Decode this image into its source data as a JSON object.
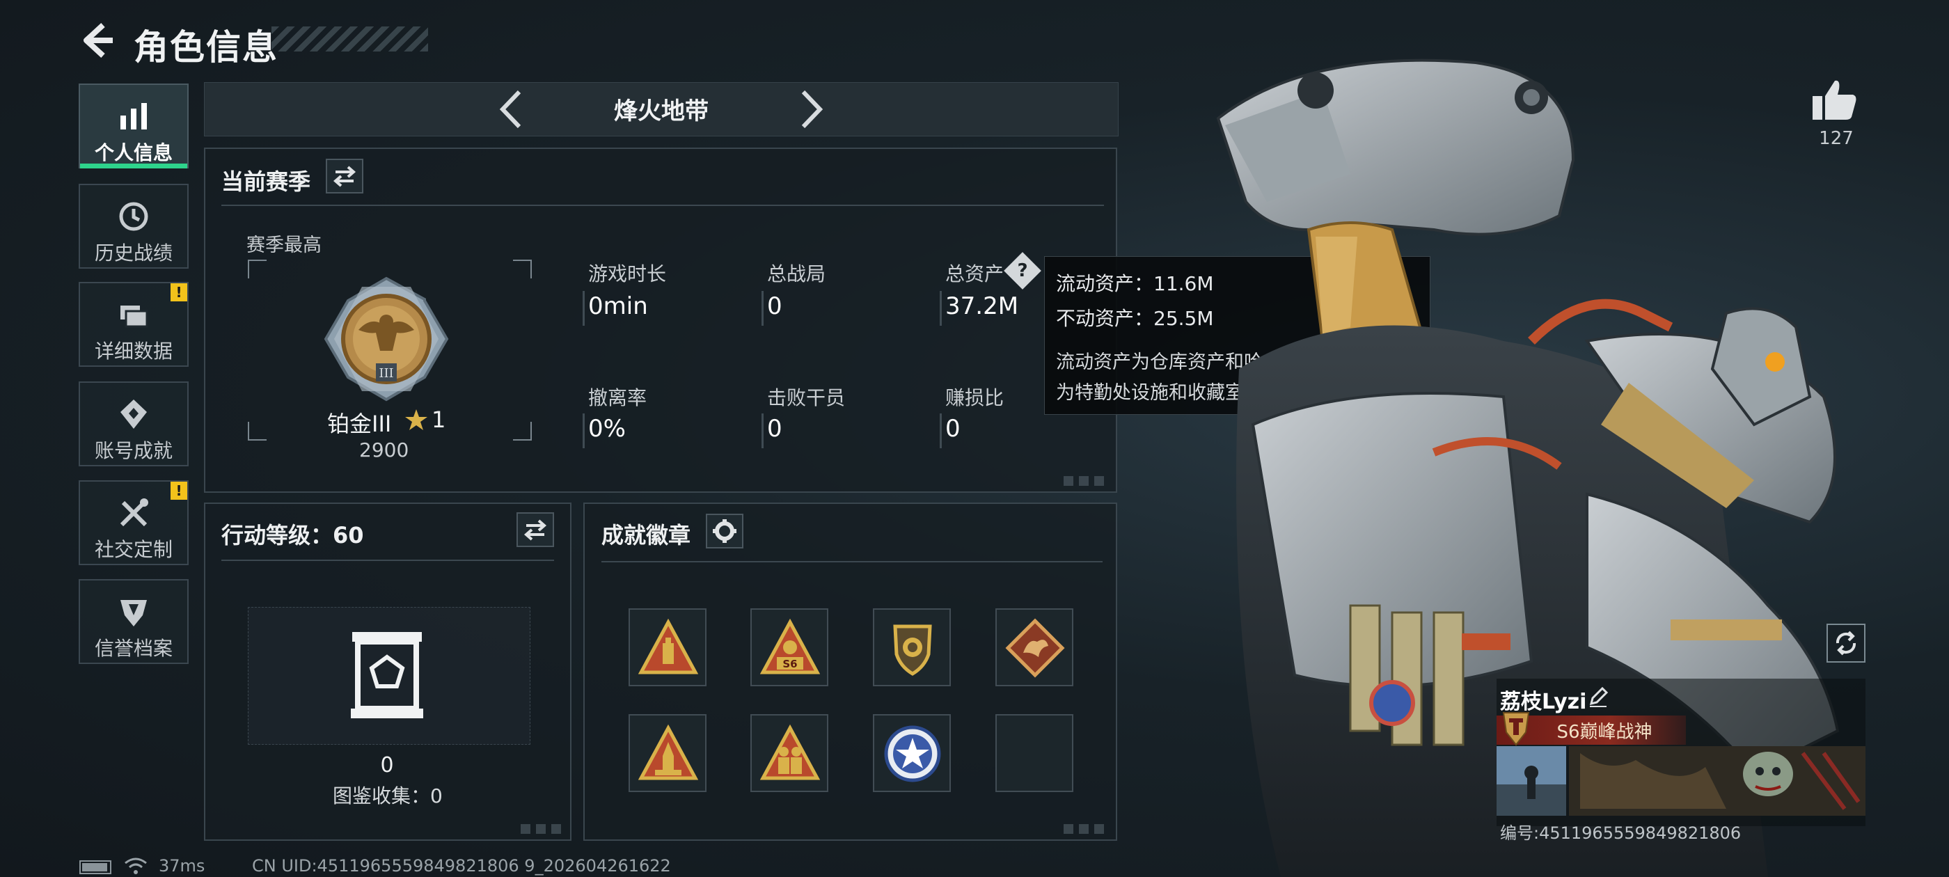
{
  "header": {
    "title": "角色信息"
  },
  "sidebar": {
    "items": [
      {
        "label": "个人信息",
        "icon": "bar-chart-icon",
        "active": true,
        "alert": false
      },
      {
        "label": "历史战绩",
        "icon": "history-icon",
        "active": false,
        "alert": false
      },
      {
        "label": "详细数据",
        "icon": "folders-icon",
        "active": false,
        "alert": true
      },
      {
        "label": "账号成就",
        "icon": "achievement-icon",
        "active": false,
        "alert": false
      },
      {
        "label": "社交定制",
        "icon": "tools-icon",
        "active": false,
        "alert": true
      },
      {
        "label": "信誉档案",
        "icon": "shield-icon",
        "active": false,
        "alert": false
      }
    ],
    "alert_mark": "!"
  },
  "mode_selector": {
    "title": "烽火地带"
  },
  "season": {
    "title": "当前赛季",
    "best_label": "赛季最高",
    "rank_name": "铂金III",
    "rank_stars": "1",
    "rank_points": "2900",
    "stats": [
      {
        "label": "游戏时长",
        "value": "0min"
      },
      {
        "label": "总战局",
        "value": "0"
      },
      {
        "label": "总资产",
        "value": "37.2M"
      },
      {
        "label": "撤离率",
        "value": "0%"
      },
      {
        "label": "击败干员",
        "value": "0"
      },
      {
        "label": "赚损比",
        "value": "0"
      }
    ],
    "help_mark": "?"
  },
  "tooltip": {
    "liquid": "流动资产：11.6M",
    "fixed": "不动资产：25.5M",
    "desc_line1": "流动资产为仓库资产和哈夫币，不动资产",
    "desc_line2": "为特勤处设施和收藏室设施"
  },
  "level": {
    "title": "行动等级：60",
    "count": "0",
    "collection": "图鉴收集：0"
  },
  "achievements": {
    "title": "成就徽章",
    "badges": [
      "triangle-bottle-badge",
      "triangle-s6-badge",
      "shield-lion-badge",
      "dragon-diamond-badge",
      "triangle-rocket-badge",
      "triangle-soldiers-badge",
      "star-medal-badge",
      "empty-slot"
    ],
    "s6_text": "S6"
  },
  "profile": {
    "likes": "127",
    "name": "荔枝Lyzi",
    "title": "S6巅峰战神",
    "id": "编号:4511965559849821806"
  },
  "status_bar": {
    "ping": "37ms",
    "uid": "CN UID:4511965559849821806 9_202604261622"
  },
  "colors": {
    "accent": "#2ed48c",
    "alert": "#f2c21b",
    "panel_border": "#3a464e"
  }
}
